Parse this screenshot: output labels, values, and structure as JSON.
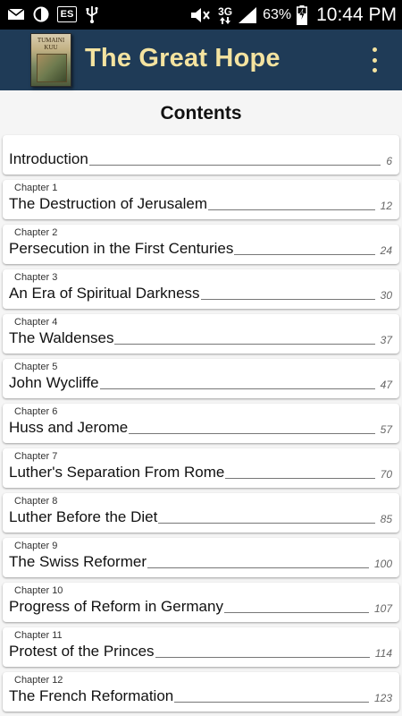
{
  "status_bar": {
    "icons_left": [
      "mail-icon",
      "sync-icon",
      "es-file-icon",
      "usb-icon"
    ],
    "es_label": "ES",
    "network_type": "3G",
    "battery_percent": "63%",
    "time": "10:44 PM"
  },
  "app_bar": {
    "title": "The Great Hope",
    "cover_title": "TUMAINI KUU",
    "menu_icon": "overflow-menu-icon"
  },
  "contents": {
    "heading": "Contents",
    "items": [
      {
        "chapter": "",
        "title": "Introduction",
        "page": "6"
      },
      {
        "chapter": "Chapter 1",
        "title": "The Destruction of Jerusalem",
        "page": "12"
      },
      {
        "chapter": "Chapter 2",
        "title": "Persecution in the First Centuries",
        "page": "24"
      },
      {
        "chapter": "Chapter 3",
        "title": "An Era of Spiritual Darkness",
        "page": "30"
      },
      {
        "chapter": "Chapter 4",
        "title": "The Waldenses",
        "page": "37"
      },
      {
        "chapter": "Chapter 5",
        "title": "John Wycliffe",
        "page": "47"
      },
      {
        "chapter": "Chapter 6",
        "title": "Huss and Jerome",
        "page": "57"
      },
      {
        "chapter": "Chapter 7",
        "title": "Luther's Separation From Rome",
        "page": "70"
      },
      {
        "chapter": "Chapter 8",
        "title": "Luther Before the Diet",
        "page": "85"
      },
      {
        "chapter": "Chapter 9",
        "title": "The Swiss Reformer",
        "page": "100"
      },
      {
        "chapter": "Chapter 10",
        "title": "Progress of Reform in Germany",
        "page": "107"
      },
      {
        "chapter": "Chapter 11",
        "title": "Protest of the Princes",
        "page": "114"
      },
      {
        "chapter": "Chapter 12",
        "title": "The French Reformation",
        "page": "123"
      }
    ]
  },
  "colors": {
    "app_bar": "#1f3b57",
    "title_text": "#f4e3a0",
    "background": "#f5f5f5"
  }
}
